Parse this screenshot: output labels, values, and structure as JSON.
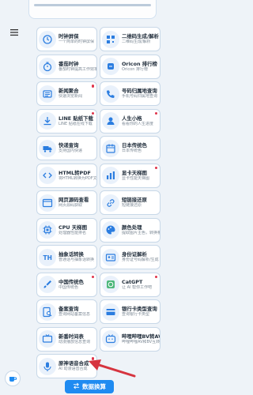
{
  "tools": [
    {
      "title": "时钟屏保",
      "sub": "一个简单的时钟屏保",
      "icon": "clock-icon",
      "dot": false
    },
    {
      "title": "二维码生成/解析",
      "sub": "二维码生成/解析",
      "icon": "qrcode-icon",
      "dot": false
    },
    {
      "title": "番茄时钟",
      "sub": "番茄时钟提高工作效率",
      "icon": "timer-icon",
      "dot": false
    },
    {
      "title": "Oricon 排行榜",
      "sub": "Oricon 排行榜",
      "icon": "trophy-icon",
      "dot": false
    },
    {
      "title": "新闻聚合",
      "sub": "快速浏览新闻",
      "icon": "news-icon",
      "dot": true
    },
    {
      "title": "号码归属地查询",
      "sub": "手机号码归属地查询",
      "icon": "phone-icon",
      "dot": false
    },
    {
      "title": "LINE 贴纸下载",
      "sub": "LINE 贴纸在线下载",
      "icon": "download-icon",
      "dot": true
    },
    {
      "title": "人生小格",
      "sub": "看看你的人生进度",
      "icon": "person-grid-icon",
      "dot": true
    },
    {
      "title": "快递查询",
      "sub": "支持国内快递",
      "icon": "truck-icon",
      "dot": false
    },
    {
      "title": "日本传统色",
      "sub": "日本传统色",
      "icon": "calendar-icon",
      "dot": false
    },
    {
      "title": "HTML转PDF",
      "sub": "将HTML转换为PDF文件",
      "icon": "html-icon",
      "dot": false
    },
    {
      "title": "显卡天梯图",
      "sub": "显卡性能天梯图",
      "icon": "bar-chart-icon",
      "dot": true
    },
    {
      "title": "网页源码查看",
      "sub": "网页源码获取",
      "icon": "code-icon",
      "dot": false
    },
    {
      "title": "短链接还原",
      "sub": "短链接还原",
      "icon": "link-icon",
      "dot": false
    },
    {
      "title": "CPU 天梯图",
      "sub": "处理器性能排名",
      "icon": "cpu-icon",
      "dot": false
    },
    {
      "title": "颜色处理",
      "sub": "提取图片主色，转换格式",
      "icon": "palette-icon",
      "dot": false
    },
    {
      "title": "抽象话转换",
      "sub": "普通话与抽象话转换",
      "icon": "text-icon",
      "dot": false
    },
    {
      "title": "身份证解析",
      "sub": "身份证号码解析/生成",
      "icon": "id-card-icon",
      "dot": false
    },
    {
      "title": "中国传统色",
      "sub": "中国传统色",
      "icon": "brush-icon",
      "dot": true
    },
    {
      "title": "CatGPT",
      "sub": "让 AI 帮你工作吧",
      "icon": "bot-icon",
      "dot": true
    },
    {
      "title": "备案查询",
      "sub": "查询网站备案信息",
      "icon": "search-doc-icon",
      "dot": false
    },
    {
      "title": "银行卡类型查询",
      "sub": "查询银行卡类型",
      "icon": "bank-card-icon",
      "dot": false
    },
    {
      "title": "新番时间表",
      "sub": "动漫播放信息查询",
      "icon": "tv-icon",
      "dot": false
    },
    {
      "title": "哔哩哔哩BV转AV",
      "sub": "哔哩哔哩AV和BV互转",
      "icon": "bilibili-icon",
      "dot": false
    },
    {
      "title": "原神语音合成",
      "sub": "AI 动漫语音合成",
      "icon": "mic-icon",
      "dot": true
    }
  ],
  "bottom_button": {
    "label": "数据换算",
    "icon": "swap-icon"
  },
  "fab": {
    "icon": "coffee-icon"
  },
  "menu": {
    "icon": "menu-icon"
  }
}
